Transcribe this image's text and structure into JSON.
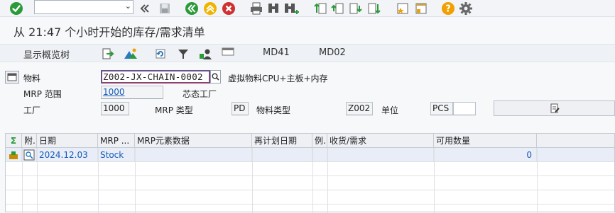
{
  "toolbar": {
    "command_field": {
      "value": "",
      "placeholder": ""
    },
    "icons": [
      "enter-icon",
      "back-double-icon",
      "save-icon",
      "back-icon",
      "exit-icon",
      "cancel-icon",
      "print-icon",
      "find-icon",
      "find-next-icon",
      "first-page-icon",
      "previous-page-icon",
      "next-page-icon",
      "last-page-icon",
      "create-session-icon",
      "shortcut-icon",
      "help-icon",
      "settings-icon"
    ]
  },
  "title": "从 21:47 个小时开始的库存/需求清单",
  "app_toolbar": {
    "show_overview_tree": "显示概览树",
    "md41": "MD41",
    "md02": "MD02"
  },
  "header": {
    "material_label": "物料",
    "material_value": "Z002-JX-CHAIN-0002",
    "material_desc": "虚拟物料CPU+主板+内存",
    "mrp_area_label": "MRP 范围",
    "mrp_area_value": "1000",
    "mrp_area_desc": "芯态工厂",
    "plant_label": "工厂",
    "plant_value": "1000",
    "mrp_type_label": "MRP 类型",
    "mrp_type_value": "PD",
    "material_type_label": "物料类型",
    "material_type_value": "Z002",
    "unit_label": "单位",
    "unit_value": "PCS"
  },
  "table": {
    "columns": [
      "Σ",
      "附.",
      "日期",
      "MRP ...",
      "MRP元素数据",
      "再计划日期",
      "例.",
      "收货/需求",
      "可用数量"
    ],
    "rows": [
      {
        "date": "2024.12.03",
        "mrp_element": "Stock",
        "element_data": "",
        "reschedule_date": "",
        "exception": "",
        "receipt_req": "",
        "available_qty": "0"
      }
    ]
  },
  "colors": {
    "accent_green": "#2a9a3a",
    "cancel_red": "#d03030",
    "focus_blue": "#1d6fc0",
    "link_blue": "#1359b8",
    "help_orange": "#f0a000"
  }
}
